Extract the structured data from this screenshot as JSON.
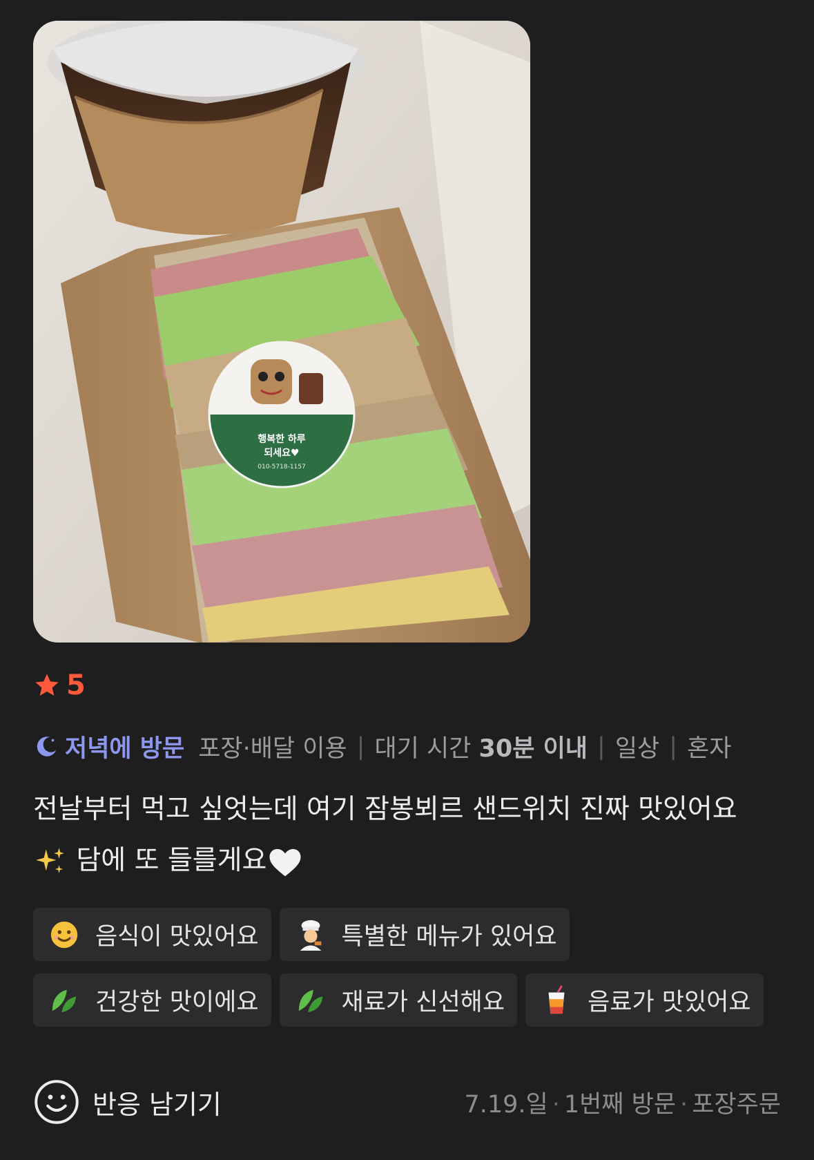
{
  "rating": {
    "value": "5",
    "star_color": "#ff5a3c"
  },
  "visit": {
    "time": "저녁에 방문",
    "method": "포장·배달 이용",
    "wait_prefix": "대기 시간",
    "wait_value": "30분 이내",
    "purpose": "일상",
    "company": "혼자"
  },
  "review": {
    "line1": "전날부터 먹고 싶엇는데 여기 잠봉뵈르 샌드위치 진짜 맛있어요",
    "line2": "담에 또 들를게요"
  },
  "sticker": {
    "line1": "행복한 하루",
    "line2": "되세요♥",
    "phone": "010-5718-1157"
  },
  "tags": [
    {
      "icon": "smile-emoji-icon",
      "label": "음식이 맛있어요"
    },
    {
      "icon": "chef-emoji-icon",
      "label": "특별한 메뉴가 있어요"
    },
    {
      "icon": "leaf-icon",
      "label": "건강한 맛이에요"
    },
    {
      "icon": "leaf-icon",
      "label": "재료가 신선해요"
    },
    {
      "icon": "drink-icon",
      "label": "음료가 맛있어요"
    }
  ],
  "footer": {
    "react_label": "반응 남기기",
    "date": "7.19.일",
    "visit_count": "1번째 방문",
    "order_type": "포장주문"
  },
  "colors": {
    "background": "#1e1e1f",
    "accent_purple": "#8e97ee",
    "tag_bg": "#2c2c2e"
  }
}
